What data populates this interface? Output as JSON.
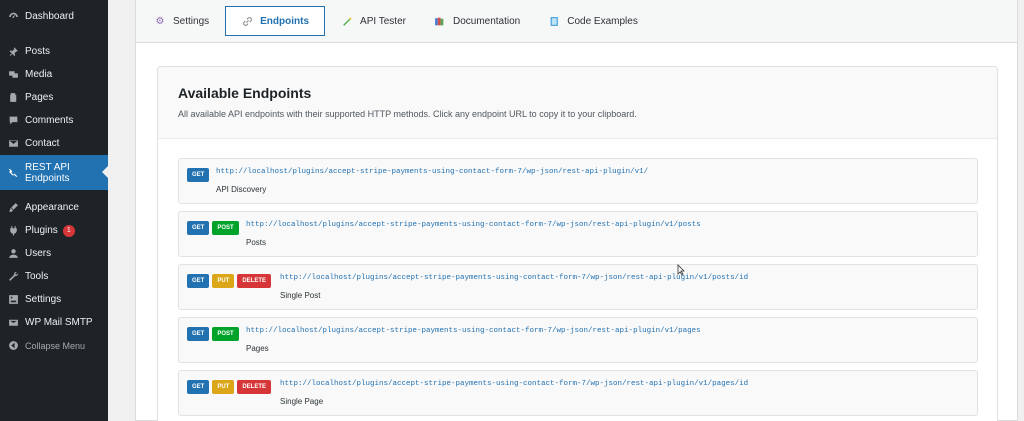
{
  "sidebar": {
    "items": [
      {
        "key": "dashboard",
        "label": "Dashboard",
        "icon": "dashboard-icon"
      },
      {
        "key": "posts",
        "label": "Posts",
        "icon": "pin-icon"
      },
      {
        "key": "media",
        "label": "Media",
        "icon": "media-icon"
      },
      {
        "key": "pages",
        "label": "Pages",
        "icon": "pages-icon"
      },
      {
        "key": "comments",
        "label": "Comments",
        "icon": "comment-icon"
      },
      {
        "key": "contact",
        "label": "Contact",
        "icon": "mail-icon"
      },
      {
        "key": "rest",
        "label_line1": "REST API",
        "label_line2": "Endpoints",
        "icon": "rest-api-icon"
      },
      {
        "key": "appearance",
        "label": "Appearance",
        "icon": "brush-icon"
      },
      {
        "key": "plugins",
        "label": "Plugins",
        "badge": "1",
        "icon": "plugin-icon"
      },
      {
        "key": "users",
        "label": "Users",
        "icon": "users-icon"
      },
      {
        "key": "tools",
        "label": "Tools",
        "icon": "wrench-icon"
      },
      {
        "key": "settings",
        "label": "Settings",
        "icon": "settings-icon"
      },
      {
        "key": "smtp",
        "label": "WP Mail SMTP",
        "icon": "mail-smtp-icon"
      },
      {
        "key": "collapse",
        "label": "Collapse Menu",
        "icon": "collapse-icon"
      }
    ]
  },
  "tabs": [
    {
      "label": "Settings",
      "icon": "gear-icon"
    },
    {
      "label": "Endpoints",
      "icon": "link-icon",
      "active": true
    },
    {
      "label": "API Tester",
      "icon": "wand-icon"
    },
    {
      "label": "Documentation",
      "icon": "books-icon"
    },
    {
      "label": "Code Examples",
      "icon": "code-book-icon"
    }
  ],
  "card": {
    "title": "Available Endpoints",
    "description": "All available API endpoints with their supported HTTP methods. Click any endpoint URL to copy it to your clipboard."
  },
  "endpoints": [
    {
      "methods": [
        "GET"
      ],
      "url": "http://localhost/plugins/accept-stripe-payments-using-contact-form-7/wp-json/rest-api-plugin/v1/",
      "name": "API Discovery"
    },
    {
      "methods": [
        "GET",
        "POST"
      ],
      "url": "http://localhost/plugins/accept-stripe-payments-using-contact-form-7/wp-json/rest-api-plugin/v1/posts",
      "name": "Posts"
    },
    {
      "methods": [
        "GET",
        "PUT",
        "DELETE"
      ],
      "url": "http://localhost/plugins/accept-stripe-payments-using-contact-form-7/wp-json/rest-api-plugin/v1/posts/id",
      "name": "Single Post"
    },
    {
      "methods": [
        "GET",
        "POST"
      ],
      "url": "http://localhost/plugins/accept-stripe-payments-using-contact-form-7/wp-json/rest-api-plugin/v1/pages",
      "name": "Pages"
    },
    {
      "methods": [
        "GET",
        "PUT",
        "DELETE"
      ],
      "url": "http://localhost/plugins/accept-stripe-payments-using-contact-form-7/wp-json/rest-api-plugin/v1/pages/id",
      "name": "Single Page"
    }
  ],
  "colors": {
    "sidebar_bg": "#1d2327",
    "accent": "#2271b1",
    "get": "#2271b1",
    "post": "#00a32a",
    "put": "#dba617",
    "delete": "#d63638"
  }
}
